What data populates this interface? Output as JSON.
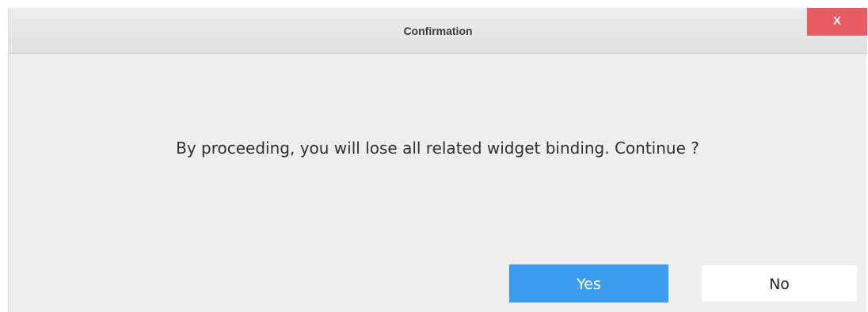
{
  "dialog": {
    "title": "Confirmation",
    "close_label": "X",
    "message": "By proceeding, you will lose all related widget binding. Continue ?",
    "buttons": {
      "yes_label": "Yes",
      "no_label": "No"
    }
  },
  "colors": {
    "close_button": "#ea5a62",
    "primary_button": "#3c9df0",
    "dialog_background": "#eeeeee"
  }
}
